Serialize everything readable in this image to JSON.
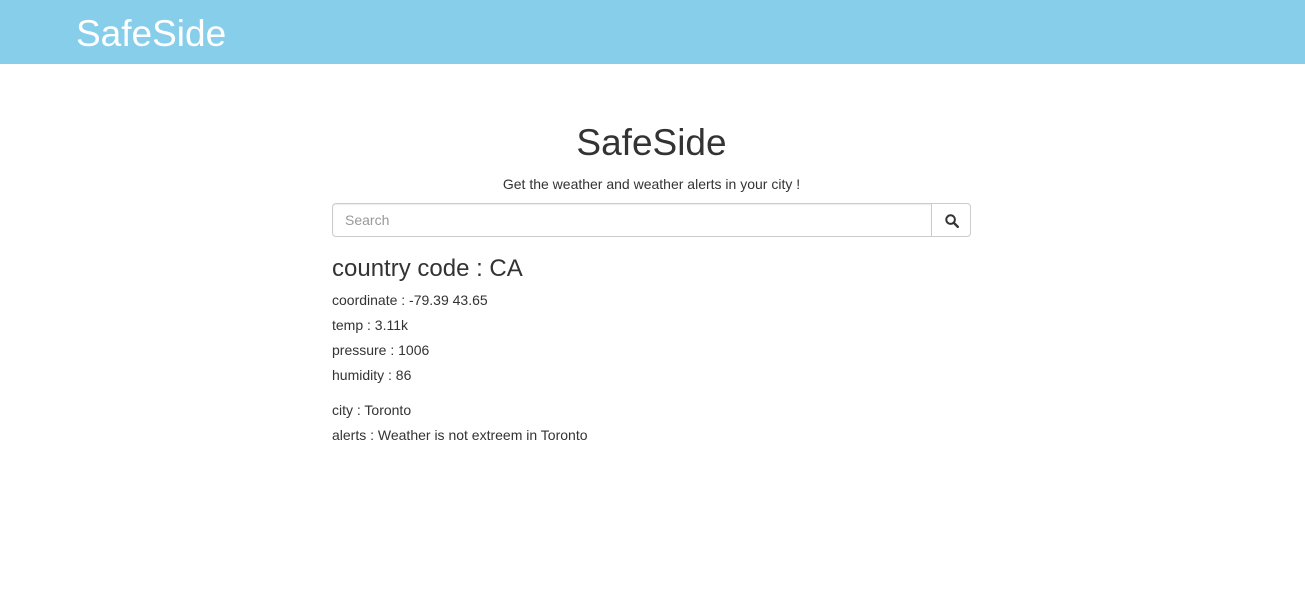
{
  "navbar": {
    "brand": "SafeSide"
  },
  "header": {
    "title": "SafeSide",
    "subtitle": "Get the weather and weather alerts in your city !"
  },
  "search": {
    "placeholder": "Search",
    "value": "",
    "button_icon": "search-icon"
  },
  "result": {
    "country": "country code : CA",
    "coordinate": "coordinate : -79.39 43.65",
    "temp": "temp : 3.11k",
    "pressure": "pressure : 1006",
    "humidity": "humidity : 86",
    "city": "city : Toronto",
    "alerts": "alerts : Weather is not extreem in Toronto"
  },
  "colors": {
    "navbar_bg": "#87ceeb",
    "text": "#333333"
  }
}
